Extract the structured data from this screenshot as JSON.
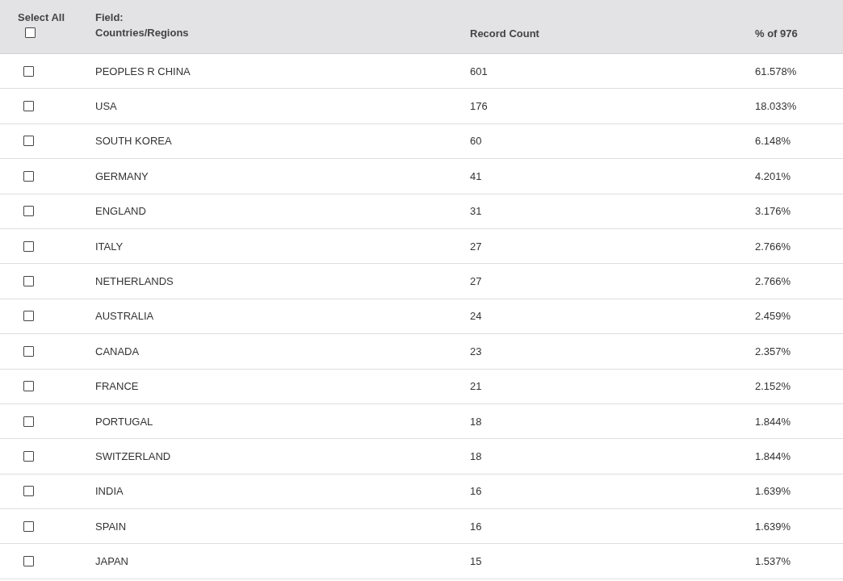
{
  "header": {
    "select_all_label": "Select All",
    "select_all_checked": false,
    "field_label": "Field:",
    "field_name": "Countries/Regions",
    "count_label": "Record Count",
    "percent_label": "% of 976"
  },
  "rows": [
    {
      "country": "PEOPLES R CHINA",
      "count": "601",
      "percent": "61.578%",
      "checked": false
    },
    {
      "country": "USA",
      "count": "176",
      "percent": "18.033%",
      "checked": false
    },
    {
      "country": "SOUTH KOREA",
      "count": "60",
      "percent": "6.148%",
      "checked": false
    },
    {
      "country": "GERMANY",
      "count": "41",
      "percent": "4.201%",
      "checked": false
    },
    {
      "country": "ENGLAND",
      "count": "31",
      "percent": "3.176%",
      "checked": false
    },
    {
      "country": "ITALY",
      "count": "27",
      "percent": "2.766%",
      "checked": false
    },
    {
      "country": "NETHERLANDS",
      "count": "27",
      "percent": "2.766%",
      "checked": false
    },
    {
      "country": "AUSTRALIA",
      "count": "24",
      "percent": "2.459%",
      "checked": false
    },
    {
      "country": "CANADA",
      "count": "23",
      "percent": "2.357%",
      "checked": false
    },
    {
      "country": "FRANCE",
      "count": "21",
      "percent": "2.152%",
      "checked": false
    },
    {
      "country": "PORTUGAL",
      "count": "18",
      "percent": "1.844%",
      "checked": false
    },
    {
      "country": "SWITZERLAND",
      "count": "18",
      "percent": "1.844%",
      "checked": false
    },
    {
      "country": "INDIA",
      "count": "16",
      "percent": "1.639%",
      "checked": false
    },
    {
      "country": "SPAIN",
      "count": "16",
      "percent": "1.639%",
      "checked": false
    },
    {
      "country": "JAPAN",
      "count": "15",
      "percent": "1.537%",
      "checked": false
    }
  ]
}
